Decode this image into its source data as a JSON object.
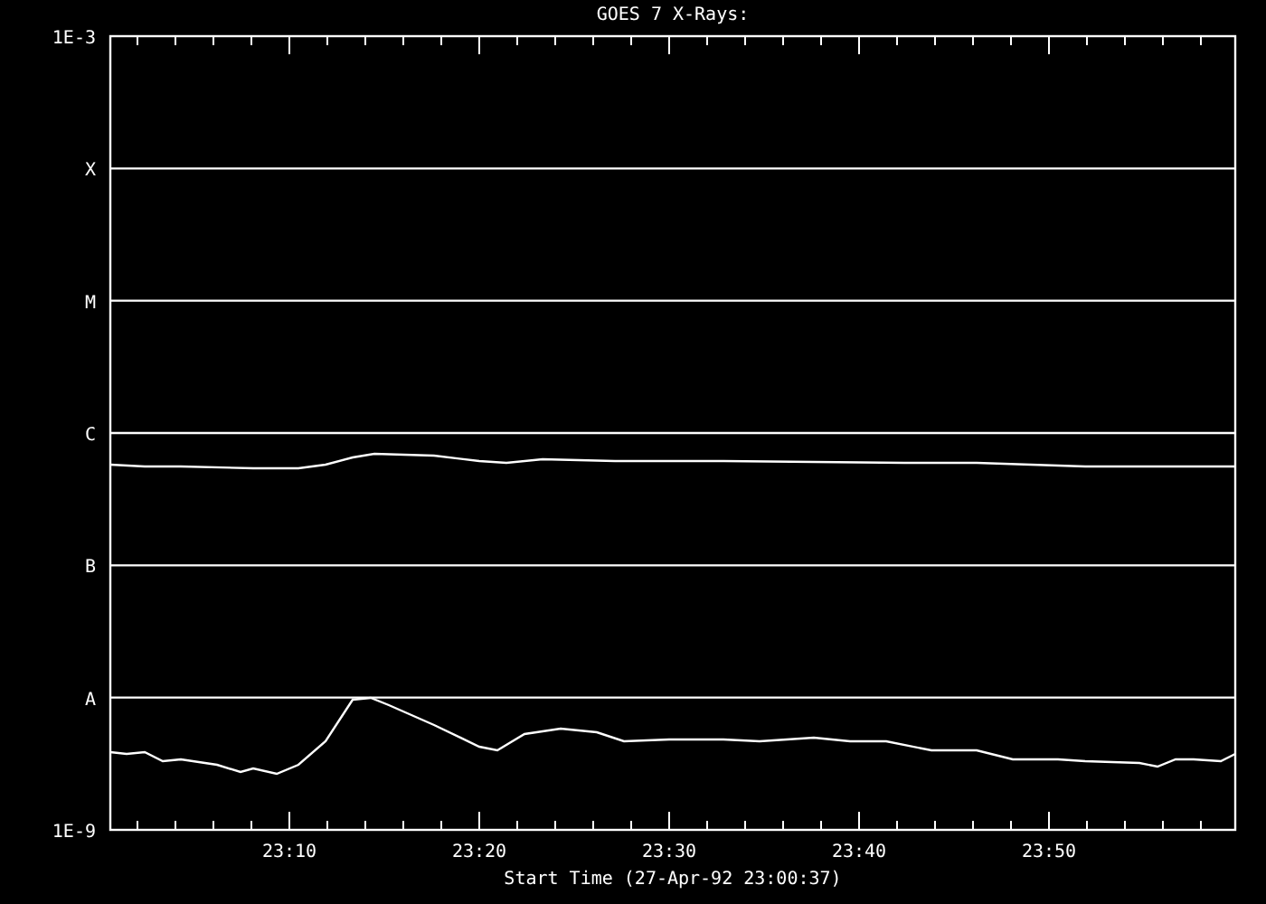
{
  "title": "GOES 7 X-Rays:",
  "y_axis_labels": [
    "1E-3",
    "X",
    "M",
    "C",
    "B",
    "A",
    "1E-9"
  ],
  "x_axis_labels": [
    "23:10",
    "23:20",
    "23:30",
    "23:40",
    "23:50"
  ],
  "x_axis_title": "Start Time (27-Apr-92 23:00:37)"
}
